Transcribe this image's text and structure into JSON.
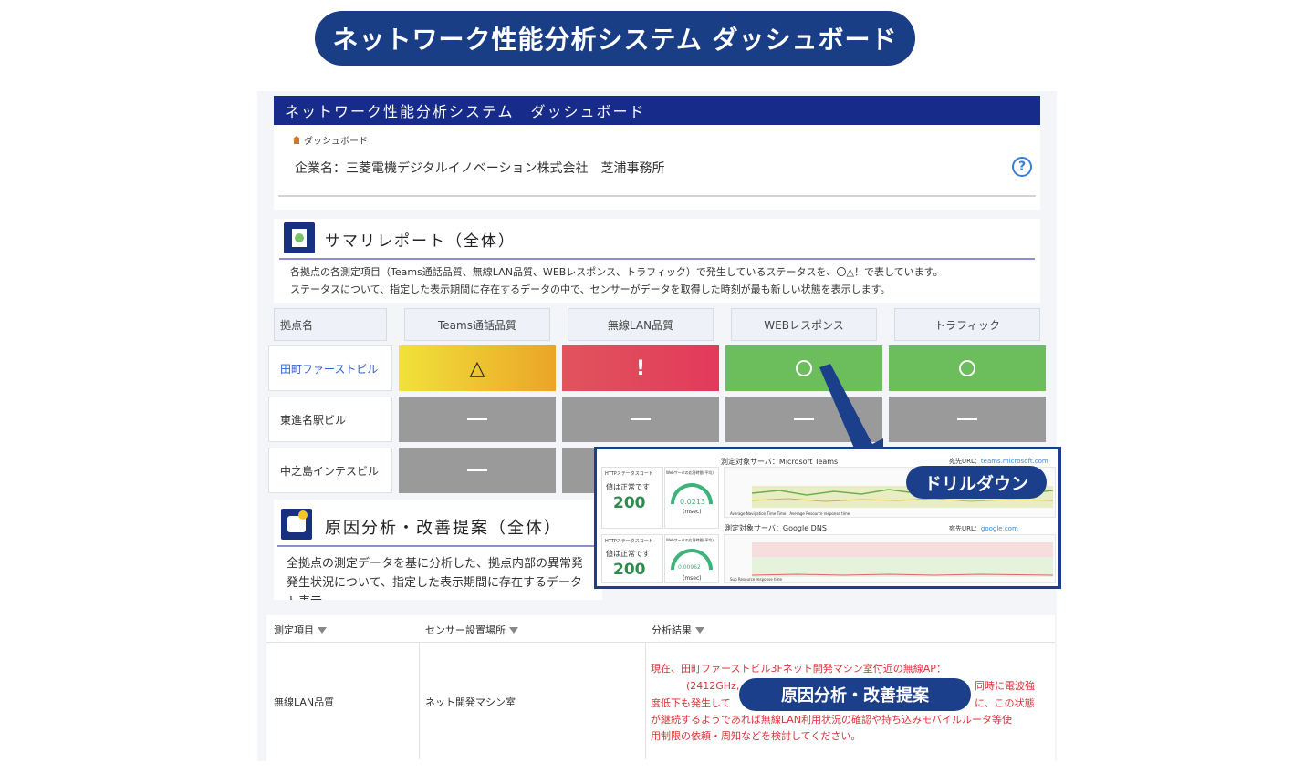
{
  "banner_title": "ネットワーク性能分析システム ダッシュボード",
  "app_header": "ネットワーク性能分析システム　ダッシュボード",
  "breadcrumb": "ダッシュボード",
  "company_label": "企業名：三菱電機デジタルイノベーション株式会社　芝浦事務所",
  "help_glyph": "?",
  "summary": {
    "title": "サマリレポート（全体）",
    "desc1": "各拠点の各測定項目（Teams通話品質、無線LAN品質、WEBレスポンス、トラフィック）で発生しているステータスを、〇△！で表しています。",
    "desc2": "ステータスについて、指定した表示期間に存在するデータの中で、センサーがデータを取得した時刻が最も新しい状態を表示します。"
  },
  "matrix": {
    "headers": [
      "拠点名",
      "Teams通話品質",
      "無線LAN品質",
      "WEBレスポンス",
      "トラフィック"
    ],
    "rows": [
      {
        "site": "田町ファーストビル",
        "statuses": [
          "warn",
          "error",
          "ok",
          "ok"
        ],
        "glyphs": [
          "△",
          "!"
        ]
      },
      {
        "site": "東進名駅ビル",
        "statuses": [
          "none",
          "none",
          "none",
          "none"
        ]
      },
      {
        "site": "中之島インテスビル",
        "statuses": [
          "none",
          "none",
          "none",
          "none"
        ]
      }
    ]
  },
  "cause": {
    "title": "原因分析・改善提案（全体）",
    "line1": "全拠点の測定データを基に分析した、拠点内部の異常発",
    "line2": "発生状況について、指定した表示期間に存在するデータ",
    "line3": "ト表示"
  },
  "drilldown": {
    "label": "ドリルダウン",
    "server1": "測定対象サーバ：Microsoft Teams",
    "url1_label": "宛先URL：",
    "url1": "teams.microsoft.com",
    "server2": "測定対象サーバ：Google DNS",
    "url2_label": "宛先URL：",
    "url2": "google.com",
    "http_label": "HTTPステータスコード",
    "normal": "値は正常です",
    "code": "200",
    "rt_label": "Webサーバの応答時間(平均)",
    "val1": "0.0213",
    "val2": "0.00962",
    "unit": "(msec)",
    "legend1a": "Average Navigation Time Time",
    "legend1b": "Average Resource response time",
    "legend2": "Sub Resource response time"
  },
  "table": {
    "headers": [
      "測定項目",
      "センサー設置場所",
      "分析結果"
    ],
    "row": {
      "item": "無線LAN品質",
      "place": "ネット開発マシン室",
      "result": [
        "現在、田町ファーストビル3Fネット開発マシン室付近の無線AP：",
        "(2412GHz,",
        "同時に電波強",
        "度低下も発生して",
        "に、この状態",
        "が継続するようであれば無線LAN利用状況の確認や持ち込みモバイルルータ等使",
        "用制限の依頼・周知などを検討してください。"
      ]
    }
  },
  "cause_badge": "原因分析・改善提案",
  "colors": {
    "banner": "#1a3e86",
    "header": "#172c8a",
    "warn": "#f0c030",
    "error": "#e04858",
    "ok": "#6cbd5c",
    "none": "#9a9a9a",
    "result_text": "#d8343a"
  }
}
